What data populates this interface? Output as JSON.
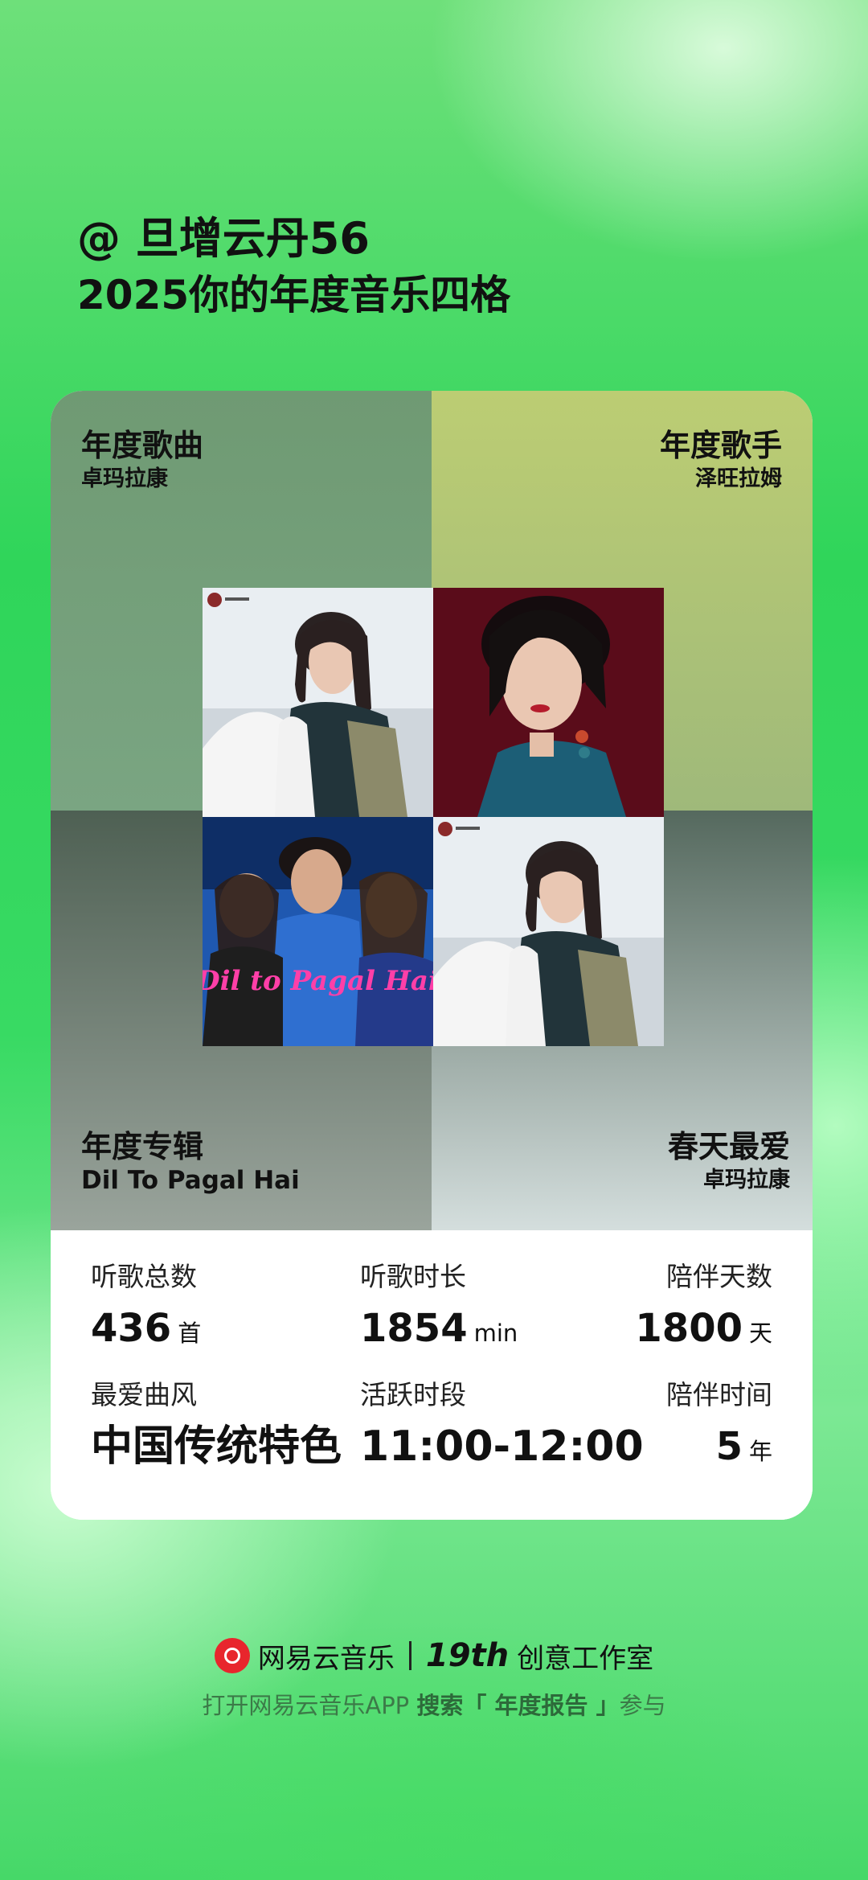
{
  "header": {
    "user": "@ 旦增云丹56",
    "title": "2025你的年度音乐四格"
  },
  "quadrants": {
    "song": {
      "heading": "年度歌曲",
      "value": "卓玛拉康"
    },
    "artist": {
      "heading": "年度歌手",
      "value": "泽旺拉姆"
    },
    "album": {
      "heading": "年度专辑",
      "value": "Dil To Pagal Hai"
    },
    "spring": {
      "heading": "春天最爱",
      "value": "卓玛拉康"
    }
  },
  "album_cover_text": "Dil to Pagal Hai",
  "stats": {
    "total_songs": {
      "label": "听歌总数",
      "value": "436",
      "unit": "首"
    },
    "listen_time": {
      "label": "听歌时长",
      "value": "1854",
      "unit": "min"
    },
    "days": {
      "label": "陪伴天数",
      "value": "1800",
      "unit": "天"
    },
    "genre": {
      "label": "最爱曲风",
      "value": "中国传统特色"
    },
    "active": {
      "label": "活跃时段",
      "value": "11:00-12:00"
    },
    "years": {
      "label": "陪伴时间",
      "value": "5",
      "unit": "年"
    }
  },
  "footer": {
    "brand": "网易云音乐",
    "edition": "19th",
    "studio": "创意工作室",
    "hint_prefix": "打开网易云音乐APP ",
    "hint_search": "搜索「 年度报告 」",
    "hint_suffix": "参与"
  },
  "colors": {
    "brand_red": "#e8262d",
    "accent_green": "#2fd55a"
  }
}
